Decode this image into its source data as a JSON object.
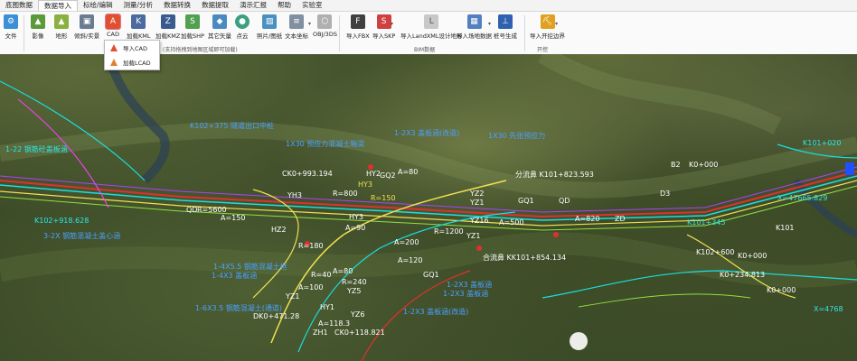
{
  "menu": {
    "tabs": [
      "底图数据",
      "数据导入",
      "标绘/编辑",
      "测量/分析",
      "数据转换",
      "数据提取",
      "演示汇报",
      "帮助",
      "实验室"
    ],
    "active_tab": "数据导入"
  },
  "toolbar": {
    "file": "文件",
    "image": "影像",
    "terrain": "地形",
    "tilt": "倾斜/实景",
    "cad": "CAD",
    "load_kml": "加载KML",
    "load_kmz": "加载KMZ",
    "load_shp": "加载SHP",
    "other_vector": "其它矢量",
    "point_cloud": "点云",
    "photo_video": "照片/图纸",
    "text_coord": "文本坐标",
    "obj_3ds": "OBJ/3DS",
    "import_fbx": "导入FBX",
    "import_skp": "导入SKP",
    "import_landxml": "导入LandXML设计地形",
    "import_site": "导入场地数据",
    "pile_gen": "桩号生成",
    "import_excavation": "导入开挖边界",
    "group_left": "(支持拖拽到地图区域即可加载)",
    "group_bim": "BIM数据",
    "group_excavation": "开挖"
  },
  "cad_menu": {
    "import_cad": "导入CAD",
    "load_cad": "加载LCAD"
  },
  "map_labels": {
    "l01": "1-22 钢筋砼盖板涵",
    "l02": "K102+918.628",
    "l03": "3-2X 钢筋混凝土盖心涵",
    "l04": "CK0+993.194",
    "l05": "R=800",
    "l06": "HY3",
    "l07": "R=150",
    "l08": "HY2",
    "l09": "GQ2",
    "l10": "A=80",
    "l11": "YH3",
    "l12": "QD",
    "l13": "R=5600",
    "l14": "A=150",
    "l15": "HY3",
    "l16": "A=90",
    "l17": "R=1200",
    "l18": "YZ1",
    "l19": "YZ2",
    "l20": "YZ1",
    "l21": "HZ2",
    "l22": "R=180",
    "l23": "A=200",
    "l24": "A=120",
    "l25": "A=80",
    "l26": "R=40",
    "l27": "R=240",
    "l28": "YZ5",
    "l29": "A=100",
    "l30": "YZ1",
    "l31": "HY1",
    "l32": "YZ6",
    "l33": "DK0+471.28",
    "l34": "A=118.3",
    "l35": "ZH1",
    "l36": "CK0+118.821",
    "l37": "分流鼻 K101+823.593",
    "l38": "合流鼻 KK101+854.134",
    "l39": "GQ1",
    "l40": "QD",
    "l41": "YZ16",
    "l42": "A=500",
    "l43": "A=820",
    "l44": "ZD",
    "l45": "B2",
    "l46": "K0+000",
    "l47": "K101+020",
    "l48": "K0+234.813",
    "l49": "K0+000",
    "l50": "X=47665.829",
    "l51": "K101",
    "l52": "K101+345",
    "l53": "GQ1",
    "l54": "K102+600",
    "l55": "K0+000",
    "l56": "1-4X3 盖板涵",
    "l57": "1-2X3 盖板涵",
    "l58": "K102+375 隧道出口中桩",
    "l59": "1-2X3 盖板涵(改造)",
    "l60": "1-6X3.5 钢筋混凝土(通道)",
    "l61": "1X30 预应力混凝土箱梁",
    "l62": "1-4X5.5 钢筋混凝土框",
    "l63": "1-2X3 盖板涵",
    "l64": "1-2X3 盖板涵(改造)",
    "l65": "1X30 先张预应力",
    "l66": "X=4768",
    "l67": "D3"
  },
  "colors": {
    "cyan": "#2ee6e6",
    "yellow": "#f0e050",
    "magenta": "#ff40ff",
    "blue_label": "#4aa0ff"
  }
}
